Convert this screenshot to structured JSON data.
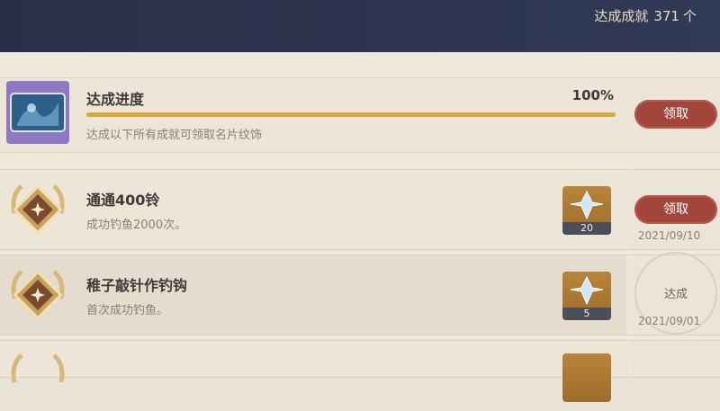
{
  "header": {
    "total_label": "达成成就",
    "total_count": "371",
    "total_unit": "个"
  },
  "progress": {
    "title": "达成进度",
    "percent_text": "100%",
    "percent_value": 1.0,
    "description": "达成以下所有成就可领取名片纹饰",
    "claim_label": "领取"
  },
  "achievements": [
    {
      "title": "通通400铃",
      "description": "成功钓鱼2000次。",
      "reward_count": "20",
      "action_label": "领取",
      "date": "2021/09/10"
    },
    {
      "title": "稚子敲针作钓钩",
      "description": "首次成功钓鱼。",
      "reward_count": "5",
      "action_label": "达成",
      "date": "2021/09/01"
    }
  ],
  "colors": {
    "accent": "#d9a83a",
    "claim_button": "#a2463c",
    "header_bg": "#2d3550"
  },
  "icons": {
    "reward": "primogem-icon",
    "medal": "achievement-medal-icon",
    "card": "namecard-icon"
  }
}
